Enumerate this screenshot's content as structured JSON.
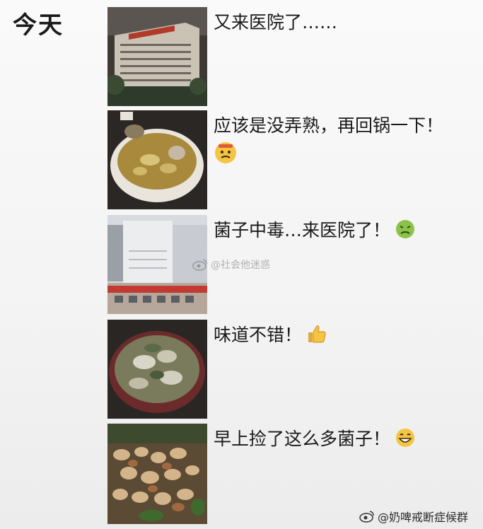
{
  "header": {
    "day_label": "今天"
  },
  "entries": [
    {
      "caption": "又来医院了……",
      "image": "hospital-building-night-photo",
      "emoji": ""
    },
    {
      "caption": "应该是没弄熟，再回锅一下！",
      "image": "mushroom-soup-pot-photo",
      "emoji": "nervous-face-emoji"
    },
    {
      "caption": "菌子中毒…来医院了！",
      "image": "hospital-building-day-photo",
      "emoji": "nauseated-face-emoji"
    },
    {
      "caption": "味道不错！",
      "image": "mushroom-stew-pot-photo",
      "emoji": "thumbs-up-emoji"
    },
    {
      "caption": "早上捡了这么多菌子！",
      "image": "wild-mushrooms-on-ground-photo",
      "emoji": "grinning-face-emoji"
    }
  ],
  "watermarks": {
    "middle": "@社会他迷惑",
    "bottom": "@奶啤戒断症候群"
  },
  "colors": {
    "background": "#f6f6f6",
    "text": "#1a1a1a",
    "emoji_yellow": "#f4c542",
    "emoji_green": "#8bc34a"
  }
}
